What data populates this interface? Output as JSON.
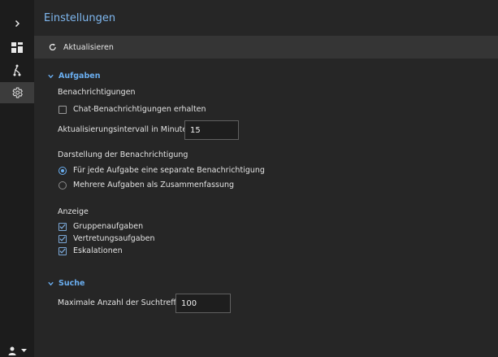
{
  "header": {
    "title": "Einstellungen"
  },
  "toolbar": {
    "refresh_label": "Aktualisieren"
  },
  "sidebar": {
    "icons": [
      "chevron-right-icon",
      "dashboard-icon",
      "flow-icon",
      "gear-icon",
      "user-icon",
      "caret-down-icon"
    ]
  },
  "aufgaben": {
    "title": "Aufgaben",
    "notifications_heading": "Benachrichtigungen",
    "chat_label": "Chat-Benachrichtigungen erhalten",
    "chat_checked": false,
    "interval_label": "Aktualisierungsintervall in Minuten",
    "interval_value": "15",
    "display_heading": "Darstellung der Benachrichtigung",
    "radio_separate": "Für jede Aufgabe eine separate Benachrichtigung",
    "radio_summary": "Mehrere Aufgaben als Zusammenfassung",
    "selected_radio": "separate",
    "anzeige_heading": "Anzeige",
    "checks": [
      {
        "label": "Gruppenaufgaben",
        "checked": true
      },
      {
        "label": "Vertretungsaufgaben",
        "checked": true
      },
      {
        "label": "Eskalationen",
        "checked": true
      }
    ]
  },
  "suche": {
    "title": "Suche",
    "max_label": "Maximale Anzahl der Suchtreffer",
    "max_value": "100"
  },
  "colors": {
    "accent": "#6aaef0",
    "title": "#7fb8f0",
    "background": "#262626",
    "sidebar": "#1c1c1c",
    "toolbar": "#353535"
  }
}
